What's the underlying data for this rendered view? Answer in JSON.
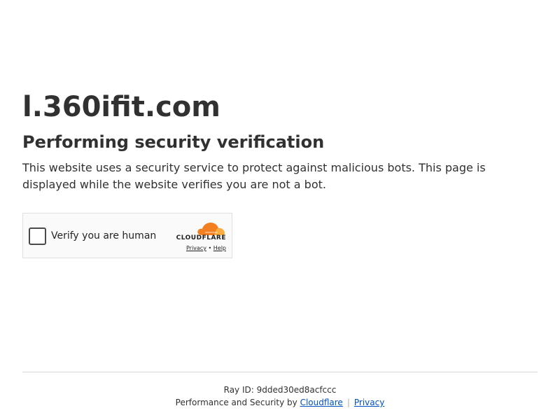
{
  "main": {
    "site_title": "l.360ifit.com",
    "heading": "Performing security verification",
    "description": "This website uses a security service to protect against malicious bots. This page is displayed while the website verifies you are not a bot."
  },
  "widget": {
    "checkbox_label": "Verify you are human",
    "brand": "CLOUDFLARE",
    "privacy_link": "Privacy",
    "link_separator": "•",
    "help_link": "Help",
    "brand_color": "#f38020"
  },
  "footer": {
    "ray_id": "Ray ID: 9dded30ed8acfccc",
    "perf_text": "Performance and Security by",
    "cloudflare_link": "Cloudflare",
    "separator": "|",
    "privacy_link": "Privacy",
    "link_color": "#0051c3"
  },
  "icons": {
    "cloud": "cloudflare-cloud-icon"
  }
}
